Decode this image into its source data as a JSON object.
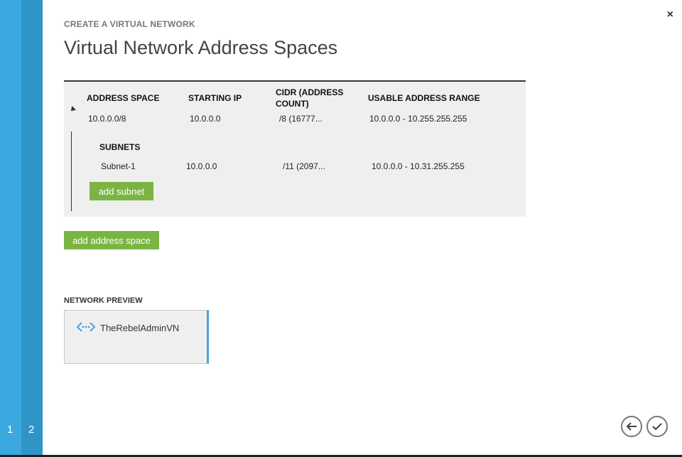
{
  "wizard": {
    "steps": [
      "1",
      "2"
    ],
    "eyebrow": "CREATE A VIRTUAL NETWORK",
    "title": "Virtual Network Address Spaces",
    "close_glyph": "×"
  },
  "address_table": {
    "headers": {
      "address_space": "ADDRESS SPACE",
      "starting_ip": "STARTING IP",
      "cidr_line1": "CIDR (ADDRESS",
      "cidr_line2": "COUNT)",
      "usable_range": "USABLE ADDRESS RANGE"
    },
    "row": {
      "address_space": "10.0.0.0/8",
      "starting_ip": "10.0.0.0",
      "cidr": "/8 (16777...",
      "usable_range": "10.0.0.0 - 10.255.255.255"
    },
    "subnets_label": "SUBNETS",
    "subnets": [
      {
        "name": "Subnet-1",
        "starting_ip": "10.0.0.0",
        "cidr": "/11 (2097...",
        "usable_range": "10.0.0.0 - 10.31.255.255"
      }
    ],
    "add_subnet_label": "add subnet"
  },
  "add_address_space_label": "add address space",
  "network_preview": {
    "label": "NETWORK PREVIEW",
    "vnet_name": "TheRebelAdminVN",
    "icon": "virtual-network-icon"
  },
  "nav": {
    "back_icon": "arrow-left-icon",
    "confirm_icon": "checkmark-icon"
  },
  "colors": {
    "rail_light": "#3aa9e0",
    "rail_dark": "#2f95c8",
    "accent_green": "#7ab544",
    "accent_blue": "#4aa2d6"
  }
}
